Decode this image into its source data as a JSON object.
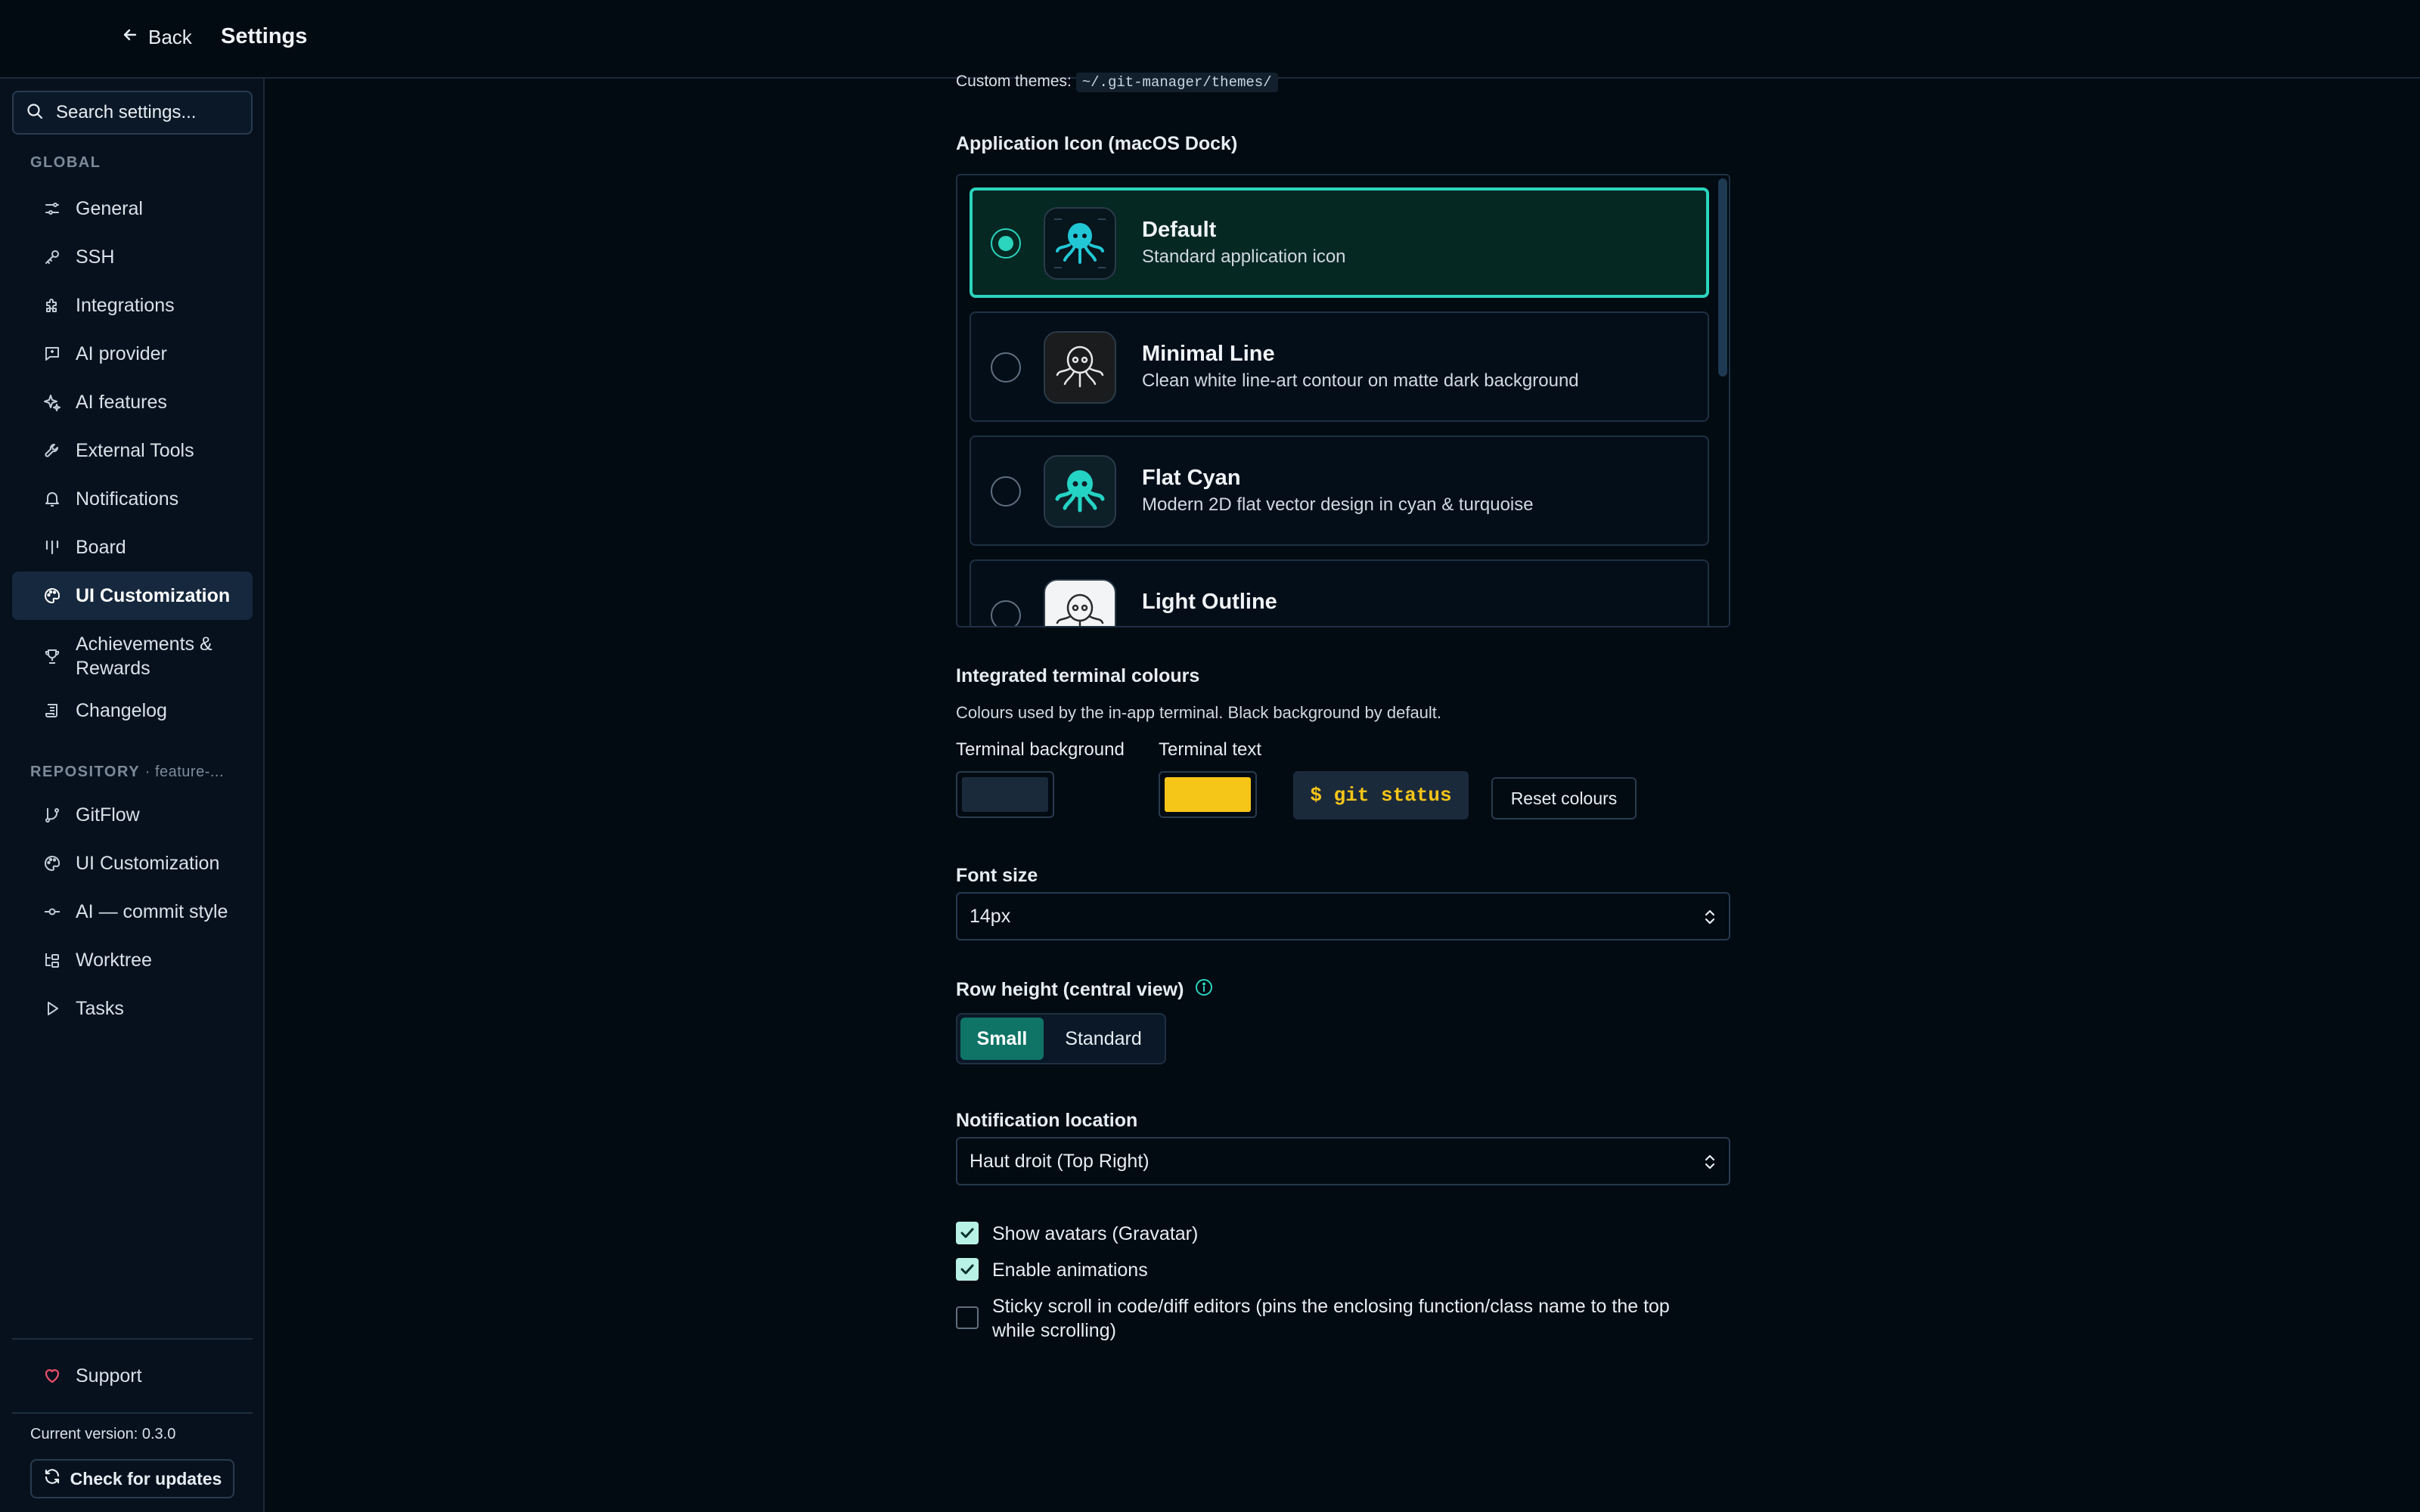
{
  "header": {
    "back_label": "Back",
    "title": "Settings"
  },
  "sidebar": {
    "search_placeholder": "Search settings...",
    "global_label": "GLOBAL",
    "global_items": [
      {
        "label": "General",
        "icon": "sliders-icon"
      },
      {
        "label": "SSH",
        "icon": "key-icon"
      },
      {
        "label": "Integrations",
        "icon": "puzzle-icon"
      },
      {
        "label": "AI provider",
        "icon": "chat-icon"
      },
      {
        "label": "AI features",
        "icon": "sparkles-icon"
      },
      {
        "label": "External Tools",
        "icon": "wrench-icon"
      },
      {
        "label": "Notifications",
        "icon": "bell-icon"
      },
      {
        "label": "Board",
        "icon": "columns-icon"
      },
      {
        "label": "UI Customization",
        "icon": "palette-icon",
        "active": true
      },
      {
        "label": "Achievements & Rewards",
        "icon": "trophy-icon"
      },
      {
        "label": "Changelog",
        "icon": "scroll-icon"
      }
    ],
    "repository_label": "REPOSITORY",
    "repository_sub": "· feature-...",
    "repository_items": [
      {
        "label": "GitFlow",
        "icon": "git-branch-icon"
      },
      {
        "label": "UI Customization",
        "icon": "palette-icon"
      },
      {
        "label": "AI — commit style",
        "icon": "git-commit-icon"
      },
      {
        "label": "Worktree",
        "icon": "folder-tree-icon"
      },
      {
        "label": "Tasks",
        "icon": "play-icon"
      }
    ],
    "support_label": "Support",
    "version_text": "Current version: 0.3.0",
    "check_updates_label": "Check for updates"
  },
  "main": {
    "custom_themes_label": "Custom themes:",
    "custom_themes_path": "~/.git-manager/themes/",
    "app_icon_title": "Application Icon (macOS Dock)",
    "app_icons": [
      {
        "title": "Default",
        "desc": "Standard application icon",
        "selected": true,
        "style": "default"
      },
      {
        "title": "Minimal Line",
        "desc": "Clean white line-art contour on matte dark background",
        "selected": false,
        "style": "minimal"
      },
      {
        "title": "Flat Cyan",
        "desc": "Modern 2D flat vector design in cyan & turquoise",
        "selected": false,
        "style": "flat"
      },
      {
        "title": "Light Outline",
        "desc": "",
        "selected": false,
        "style": "light"
      }
    ],
    "terminal": {
      "title": "Integrated terminal colours",
      "desc": "Colours used by the in-app terminal. Black background by default.",
      "bg_label": "Terminal background",
      "text_label": "Terminal text",
      "bg_color": "#1b2a3b",
      "text_color": "#f5c518",
      "preview_text": "$ git status",
      "reset_label": "Reset colours"
    },
    "font_size": {
      "label": "Font size",
      "value": "14px"
    },
    "row_height": {
      "label": "Row height (central view)",
      "options": [
        "Small",
        "Standard"
      ],
      "selected": "Small"
    },
    "notification_location": {
      "label": "Notification location",
      "value": "Haut droit (Top Right)"
    },
    "checkboxes": [
      {
        "label": "Show avatars (Gravatar)",
        "checked": true
      },
      {
        "label": "Enable animations",
        "checked": true
      },
      {
        "label": "Sticky scroll in code/diff editors (pins the enclosing function/class name to the top while scrolling)",
        "checked": false
      }
    ]
  },
  "colors": {
    "accent": "#2bd4bd",
    "background": "#020a12",
    "sidebar": "#07111e",
    "heart": "#f0506e"
  }
}
